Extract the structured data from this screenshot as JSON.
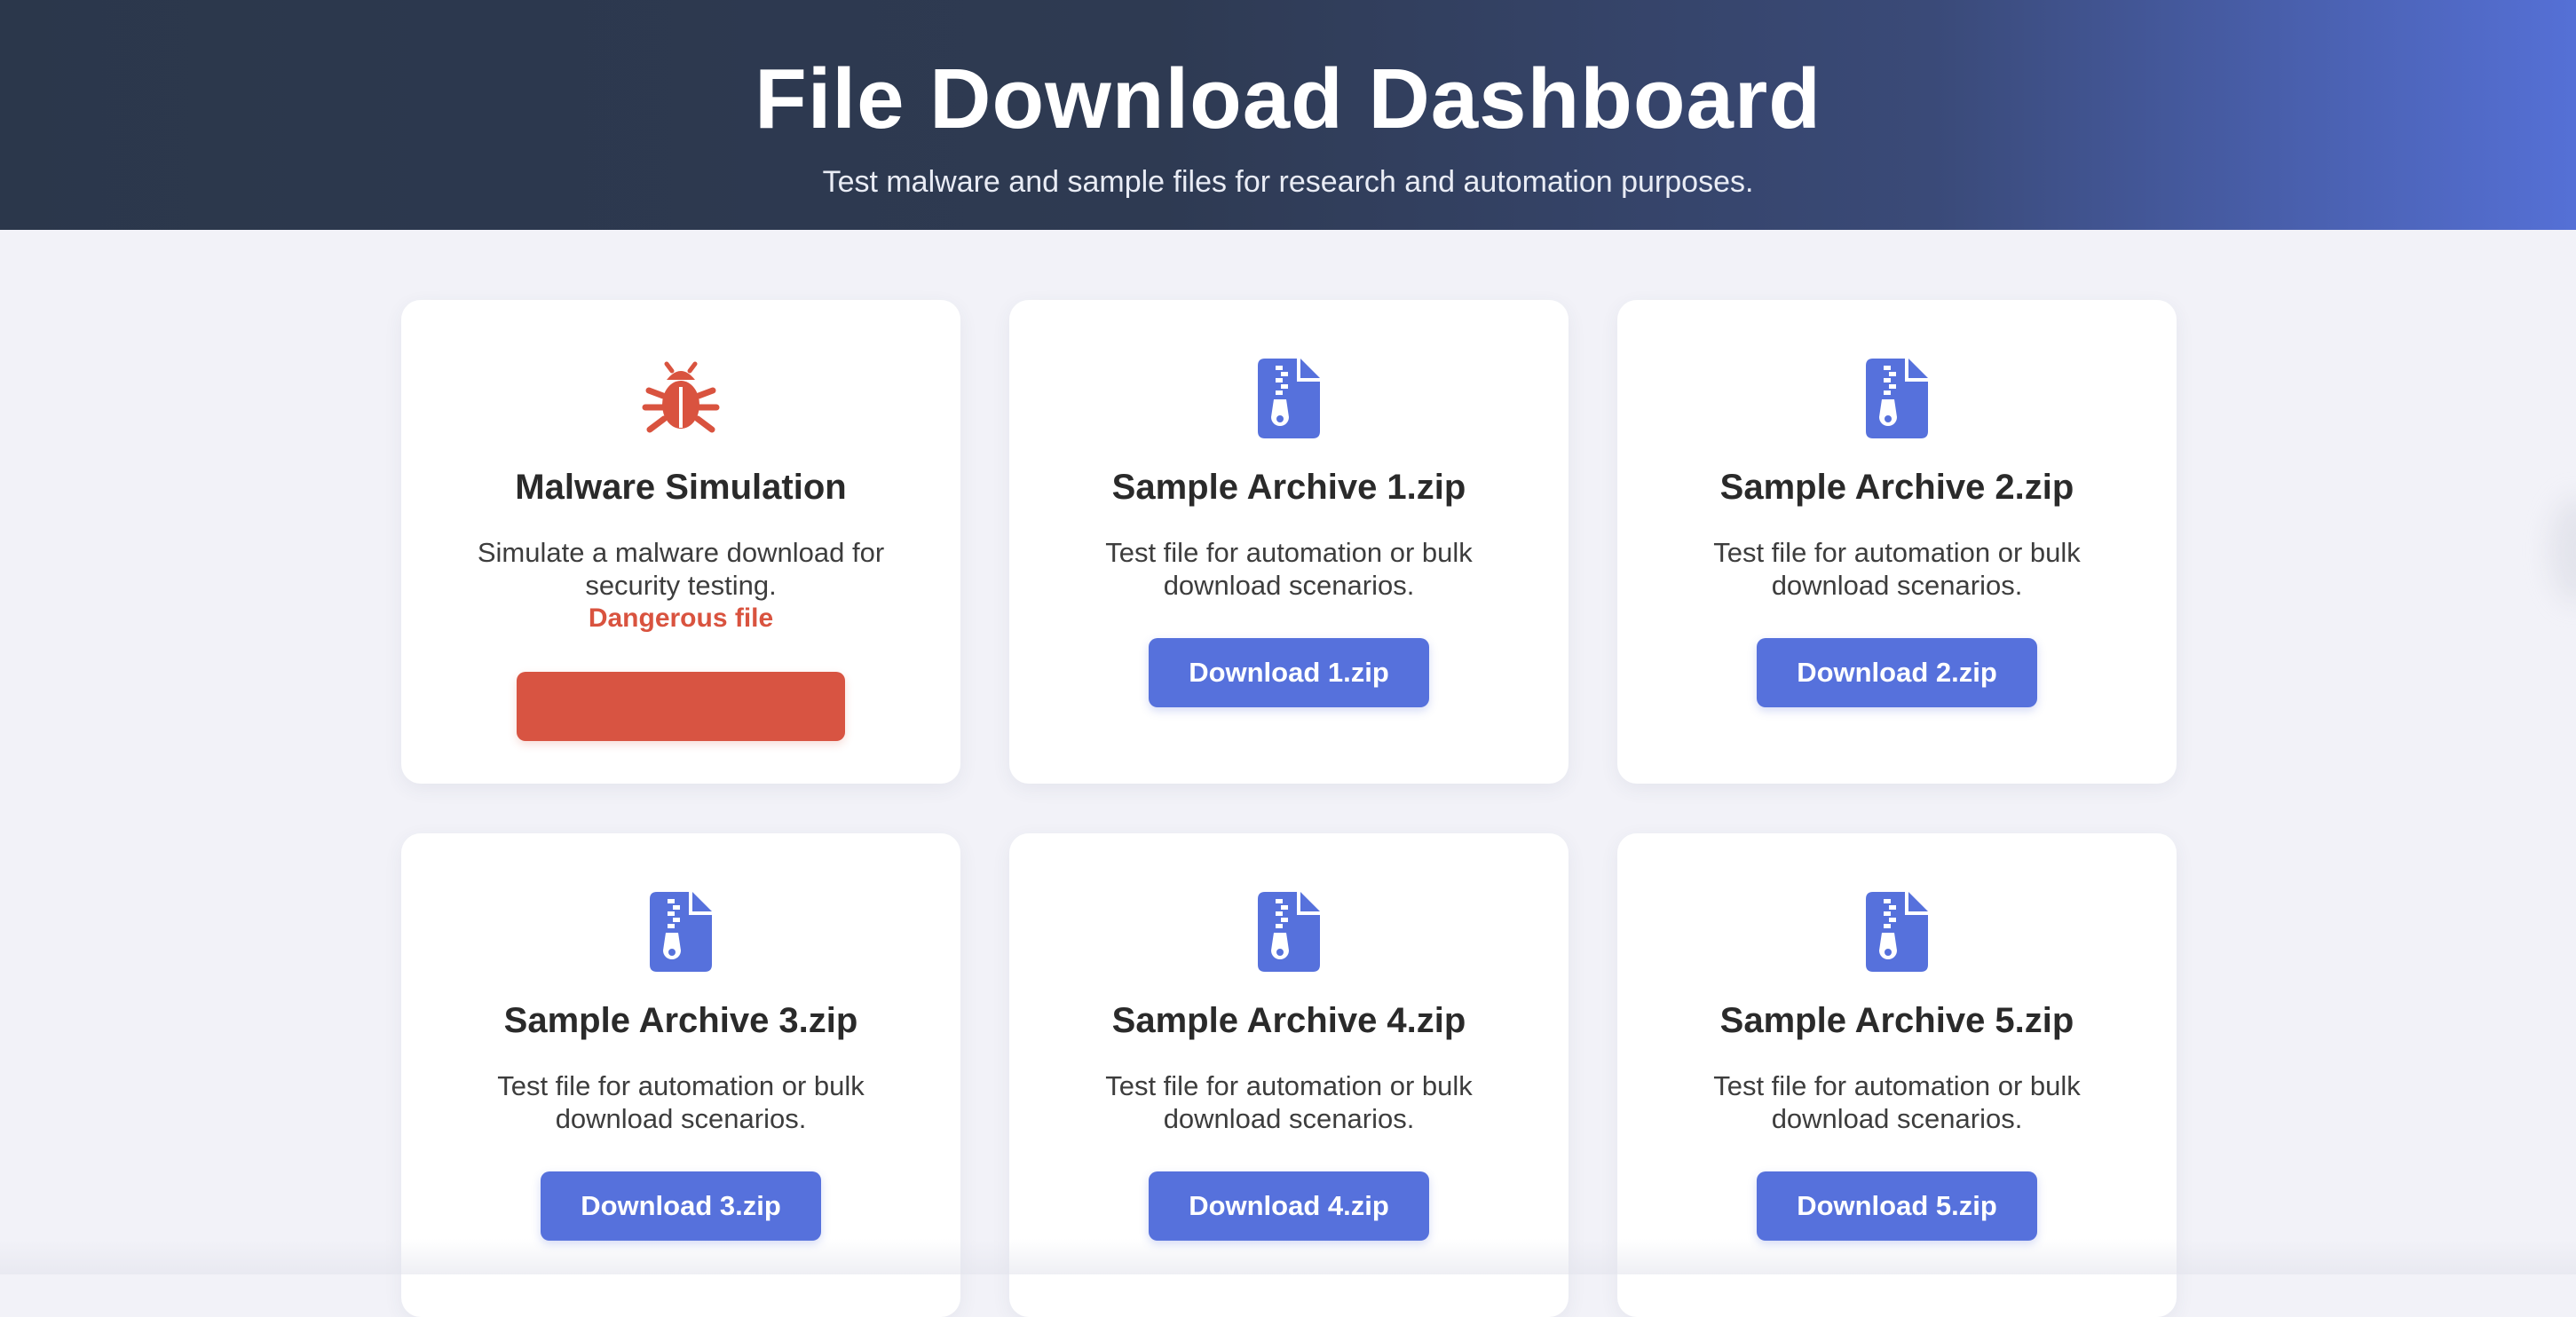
{
  "header": {
    "title": "File Download Dashboard",
    "subtitle": "Test malware and sample files for research and automation purposes."
  },
  "colors": {
    "accent": "#5671dc",
    "danger": "#d85442",
    "background": "#f2f2f8",
    "header_dark": "#2b374b"
  },
  "cards": [
    {
      "icon": "bug-icon",
      "title": "Malware Simulation",
      "description": "Simulate a malware download for security testing.",
      "warning": "Dangerous file",
      "button_label": ""
    },
    {
      "icon": "zip-file-icon",
      "title": "Sample Archive 1.zip",
      "description": "Test file for automation or bulk download scenarios.",
      "button_label": "Download 1.zip"
    },
    {
      "icon": "zip-file-icon",
      "title": "Sample Archive 2.zip",
      "description": "Test file for automation or bulk download scenarios.",
      "button_label": "Download 2.zip"
    },
    {
      "icon": "zip-file-icon",
      "title": "Sample Archive 3.zip",
      "description": "Test file for automation or bulk download scenarios.",
      "button_label": "Download 3.zip"
    },
    {
      "icon": "zip-file-icon",
      "title": "Sample Archive 4.zip",
      "description": "Test file for automation or bulk download scenarios.",
      "button_label": "Download 4.zip"
    },
    {
      "icon": "zip-file-icon",
      "title": "Sample Archive 5.zip",
      "description": "Test file for automation or bulk download scenarios.",
      "button_label": "Download 5.zip"
    }
  ]
}
